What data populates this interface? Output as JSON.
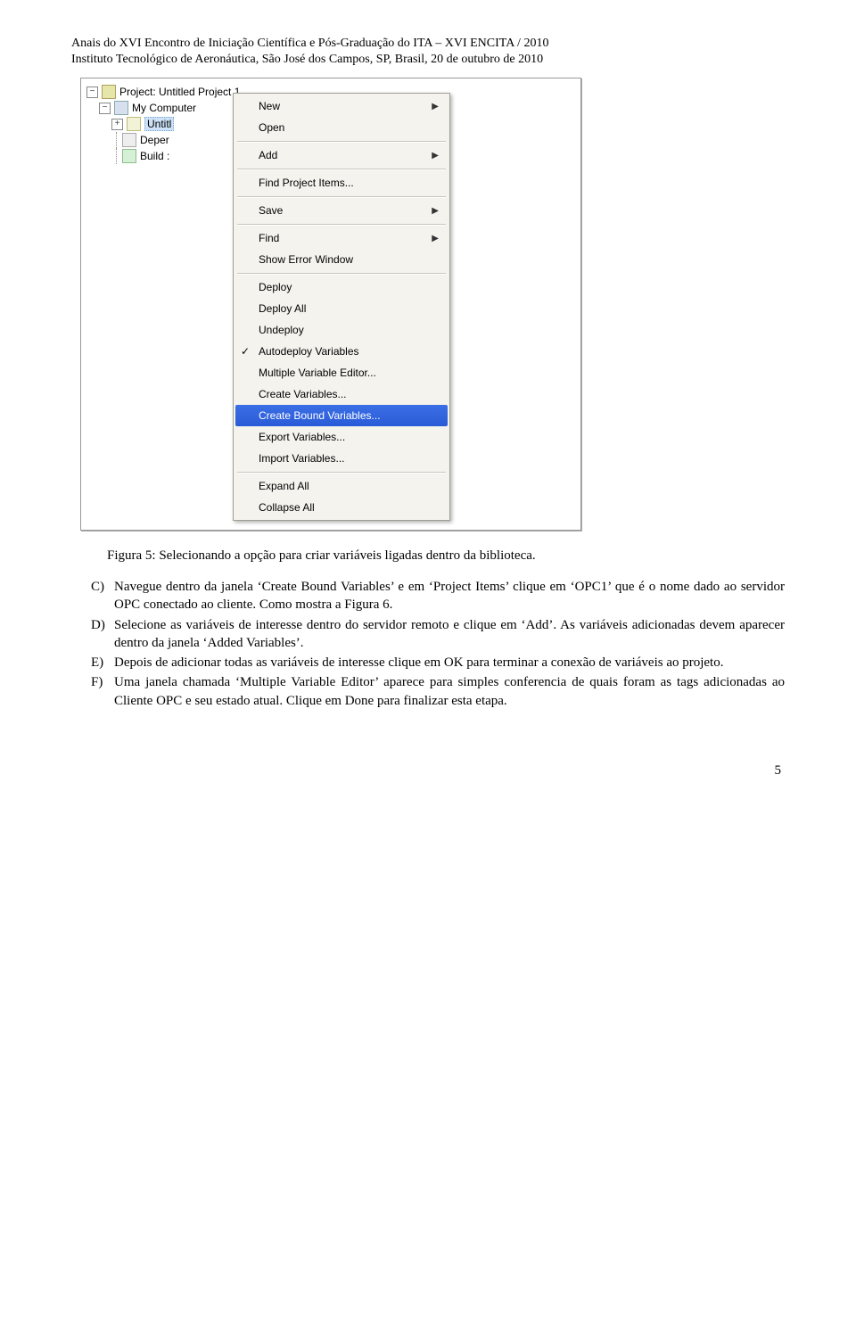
{
  "header": {
    "line1": "Anais do XVI Encontro de Iniciação Científica e Pós-Graduação do ITA – XVI  ENCITA / 2010",
    "line2": "Instituto Tecnológico de Aeronáutica, São José dos Campos, SP, Brasil, 20 de outubro de  2010"
  },
  "tree": {
    "project": "Project: Untitled Project 1",
    "computer": "My Computer",
    "untitled": "Untitl",
    "deps": "Deper",
    "build": "Build :"
  },
  "menu": {
    "new": "New",
    "open": "Open",
    "add": "Add",
    "findProjectItems": "Find Project Items...",
    "save": "Save",
    "find": "Find",
    "showError": "Show Error Window",
    "deploy": "Deploy",
    "deployAll": "Deploy All",
    "undeploy": "Undeploy",
    "autodeploy": "Autodeploy Variables",
    "multiEditor": "Multiple Variable Editor...",
    "createVars": "Create Variables...",
    "createBound": "Create Bound Variables...",
    "exportVars": "Export Variables...",
    "importVars": "Import Variables...",
    "expandAll": "Expand All",
    "collapseAll": "Collapse All"
  },
  "caption": "Figura 5: Selecionando a opção para criar variáveis ligadas dentro da biblioteca.",
  "items": {
    "c": {
      "marker": "C)",
      "text": "Navegue dentro da janela ‘Create Bound Variables’ e em ‘Project Items’ clique em ‘OPC1’ que é o nome dado ao servidor OPC conectado ao cliente. Como mostra a Figura 6."
    },
    "d": {
      "marker": "D)",
      "text": "Selecione as variáveis de interesse dentro do servidor remoto e clique em ‘Add’. As variáveis adicionadas devem aparecer dentro da janela ‘Added Variables’."
    },
    "e": {
      "marker": "E)",
      "text": "Depois de adicionar todas as variáveis de interesse clique em OK para terminar a conexão de variáveis ao projeto."
    },
    "f": {
      "marker": "F)",
      "text": "Uma janela chamada ‘Multiple Variable Editor’ aparece para simples conferencia de quais foram as tags adicionadas ao Cliente OPC e seu estado atual. Clique em Done para finalizar esta etapa."
    }
  },
  "pageNumber": "5"
}
